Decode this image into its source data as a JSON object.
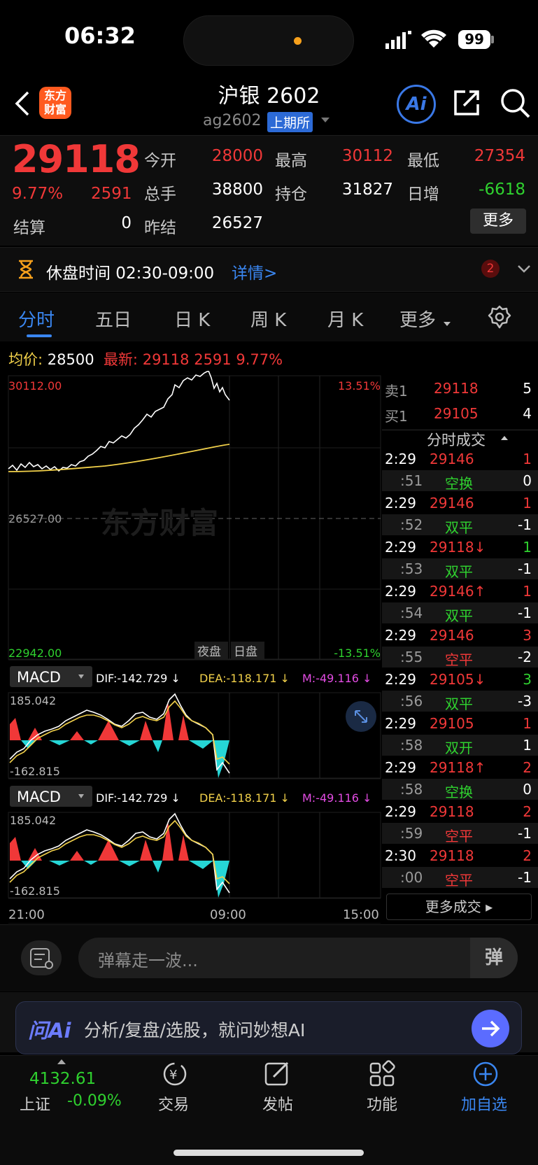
{
  "status_bar": {
    "time": "06:32",
    "battery": "99"
  },
  "header": {
    "logo_text": "东方财富",
    "title": "沪银 2602",
    "code": "ag2602",
    "exchange": "上期所"
  },
  "quote": {
    "price": "29118",
    "change_pct": "9.77%",
    "change": "2591",
    "settle_label": "结算",
    "settle": "0",
    "open_label": "今开",
    "open": "28000",
    "volume_label": "总手",
    "volume": "38800",
    "prev_settle_label": "昨结",
    "prev_settle": "26527",
    "high_label": "最高",
    "high": "30112",
    "oi_label": "持仓",
    "oi": "31827",
    "low_label": "最低",
    "low": "27354",
    "day_inc_label": "日增",
    "day_inc": "-6618",
    "more_label": "更多"
  },
  "notice": {
    "text": "休盘时间 02:30-09:00",
    "link": "详情>",
    "badge": "2"
  },
  "tabs": [
    "分时",
    "五日",
    "日 K",
    "周 K",
    "月 K",
    "更多"
  ],
  "chart_info": {
    "avg_label": "均价:",
    "avg": "28500",
    "latest_label": "最新:",
    "latest": "29118",
    "latest_change": "2591",
    "latest_pct": "9.77%"
  },
  "chart": {
    "y_high": "30112.00",
    "y_mid": "26527.00",
    "y_low": "22942.00",
    "pct_high": "13.51%",
    "pct_low": "-13.51%",
    "session_night": "夜盘",
    "session_day": "日盘",
    "watermark": "东方财富",
    "x_labels": [
      "21:00",
      "09:00",
      "15:00"
    ]
  },
  "macd1": {
    "name": "MACD",
    "dif": "DIF:-142.729 ↓",
    "dea": "DEA:-118.171 ↓",
    "m": "M:-49.116 ↓",
    "max": "185.042",
    "min": "-162.815"
  },
  "macd2": {
    "name": "MACD",
    "dif": "DIF:-142.729 ↓",
    "dea": "DEA:-118.171 ↓",
    "m": "M:-49.116 ↓",
    "max": "185.042",
    "min": "-162.815"
  },
  "order_book": {
    "sell_label": "卖1",
    "sell_price": "29118",
    "sell_qty": "5",
    "buy_label": "买1",
    "buy_price": "29105",
    "buy_qty": "4"
  },
  "trades_title": "分时成交",
  "trades": [
    {
      "time": "2:29",
      "price": "29146",
      "qty": "1",
      "sec": ":51",
      "type": "空换",
      "change": "0"
    },
    {
      "time": "2:29",
      "price": "29146",
      "qty": "1",
      "sec": ":52",
      "type": "双平",
      "change": "-1"
    },
    {
      "time": "2:29",
      "price": "29118↓",
      "qty": "1",
      "sec": ":53",
      "type": "双平",
      "change": "-1"
    },
    {
      "time": "2:29",
      "price": "29146↑",
      "qty": "1",
      "sec": ":54",
      "type": "双平",
      "change": "-1"
    },
    {
      "time": "2:29",
      "price": "29146",
      "qty": "3",
      "sec": ":55",
      "type": "空平",
      "change": "-2"
    },
    {
      "time": "2:29",
      "price": "29105↓",
      "qty": "3",
      "sec": ":56",
      "type": "双平",
      "change": "-3"
    },
    {
      "time": "2:29",
      "price": "29105",
      "qty": "1",
      "sec": ":58",
      "type": "双开",
      "change": "1"
    },
    {
      "time": "2:29",
      "price": "29118↑",
      "qty": "2",
      "sec": ":58",
      "type": "空换",
      "change": "0"
    },
    {
      "time": "2:29",
      "price": "29118",
      "qty": "2",
      "sec": ":59",
      "type": "空平",
      "change": "-1"
    },
    {
      "time": "2:30",
      "price": "29118",
      "qty": "2",
      "sec": ":00",
      "type": "空平",
      "change": "-1"
    }
  ],
  "more_trades": "更多成交 ▸",
  "danmaku": {
    "placeholder": "弹幕走一波...",
    "toggle": "弹"
  },
  "ai_bar": {
    "logo": "问Ai",
    "text": "分析/复盘/选股，就问妙想AI"
  },
  "bottom_nav": {
    "index_value": "4132.61",
    "index_name": "上证",
    "index_change": "-0.09%",
    "trade": "交易",
    "post": "发帖",
    "function": "功能",
    "add_watch": "加自选"
  },
  "colors": {
    "up": "#f03838",
    "down": "#2fd12f",
    "avg": "#f2d14a",
    "accent": "#3a86f0"
  }
}
